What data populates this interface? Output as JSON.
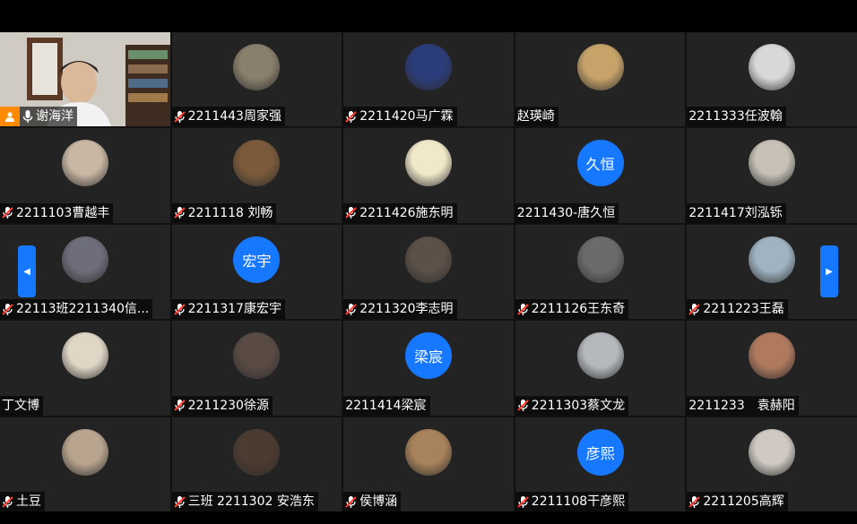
{
  "host": {
    "name": "谢海洋"
  },
  "tiles": [
    {
      "name": "2211443周家强",
      "muted": true,
      "avatar": "photo",
      "color": "#8a7f6c"
    },
    {
      "name": "2211420马广霖",
      "muted": true,
      "avatar": "photo",
      "color": "#2b3c7a"
    },
    {
      "name": "赵瑛崎",
      "muted": false,
      "avatar": "photo",
      "color": "#c7a36a"
    },
    {
      "name": "2211333任波翰",
      "muted": false,
      "avatar": "photo",
      "color": "#d8d8d8"
    },
    {
      "name": "2211103曹越丰",
      "muted": true,
      "avatar": "photo",
      "color": "#c9b7a3"
    },
    {
      "name": "2211118  刘畅",
      "muted": true,
      "avatar": "photo",
      "color": "#7a5a3a"
    },
    {
      "name": "2211426施东明",
      "muted": true,
      "avatar": "photo",
      "color": "#f1e7c9"
    },
    {
      "name": "2211430-唐久恒",
      "muted": false,
      "avatar": "text",
      "initials": "久恒"
    },
    {
      "name": "2211417刘泓铄",
      "muted": false,
      "avatar": "photo",
      "color": "#c7c1b7"
    },
    {
      "name": "22113班2211340信...",
      "muted": true,
      "avatar": "photo",
      "color": "#6e6d7a"
    },
    {
      "name": "2211317康宏宇",
      "muted": true,
      "avatar": "text",
      "initials": "宏宇"
    },
    {
      "name": "2211320李志明",
      "muted": true,
      "avatar": "photo",
      "color": "#5c5048"
    },
    {
      "name": "2211126王东奇",
      "muted": true,
      "avatar": "photo",
      "color": "#6b6b6b"
    },
    {
      "name": "2211223王磊",
      "muted": true,
      "avatar": "photo",
      "color": "#9fb3c2"
    },
    {
      "name": "丁文博",
      "muted": false,
      "avatar": "photo",
      "color": "#e0d6c6"
    },
    {
      "name": "2211230徐源",
      "muted": true,
      "avatar": "photo",
      "color": "#5a4a44"
    },
    {
      "name": "2211414梁宸",
      "muted": false,
      "avatar": "text",
      "initials": "梁宸"
    },
    {
      "name": "2211303蔡文龙",
      "muted": true,
      "avatar": "photo",
      "color": "#b5b9bd"
    },
    {
      "name": "2211233　袁赫阳",
      "muted": false,
      "avatar": "photo",
      "color": "#b07a5e"
    },
    {
      "name": "土豆",
      "muted": true,
      "avatar": "photo",
      "color": "#b9a58f"
    },
    {
      "name": "三班 2211302 安浩东",
      "muted": true,
      "avatar": "photo",
      "color": "#4c3b30"
    },
    {
      "name": "侯博涵",
      "muted": true,
      "avatar": "photo",
      "color": "#a8825a"
    },
    {
      "name": "2211108干彦熙",
      "muted": true,
      "avatar": "text",
      "initials": "彦熙"
    },
    {
      "name": "2211205高辉",
      "muted": true,
      "avatar": "photo",
      "color": "#cfc9c2"
    }
  ],
  "nav": {
    "prev_icon": "chevron-left-icon",
    "next_icon": "chevron-right-icon"
  },
  "colors": {
    "accent": "#1677ff",
    "host_badge": "#ff8a00",
    "tile_bg": "#232323"
  }
}
